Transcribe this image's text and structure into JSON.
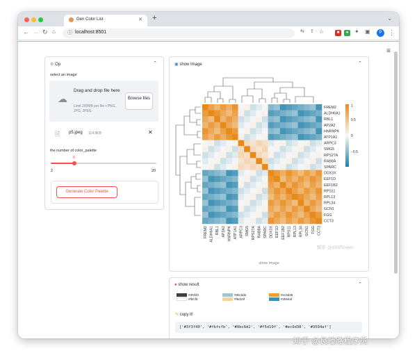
{
  "browser": {
    "tab_title": "Gen Color List",
    "url": "localhost:8501",
    "profile_initial": "P"
  },
  "sidebar": {
    "header": "Op",
    "upload_label": "select an image",
    "dropzone_title": "Drag and drop file here",
    "dropzone_hint": "Limit 200MB per file • PNG, JPG, JPEG",
    "browse_label": "Browse files",
    "file_name": "p5.jpeg",
    "file_size": "114.9KB",
    "slider_label": "the number of color_palette",
    "slider_value": 6,
    "slider_min": "2",
    "slider_max": "20",
    "slider_value_fraction": 0.222,
    "generate_label": "Generate Color Palette"
  },
  "image_panel": {
    "header": "show Image",
    "caption": "show image",
    "colorbar_ticks": [
      "1",
      "0.5",
      "0",
      "−0.5"
    ],
    "row_labels": [
      "FREM2",
      "ALDH6A1",
      "RBL1",
      "AP2A2",
      "HNRNPK",
      "ATP1A1",
      "ARPC3",
      "SMG5",
      "RPS27A",
      "RAB8A",
      "SPARC",
      "DDX3X",
      "EEF1D",
      "EEF1B2",
      "RPS11",
      "RPL13",
      "RPL34",
      "GCN1",
      "FGG",
      "CCT3"
    ],
    "col_labels": [
      "FREM2",
      "ALDH6A1",
      "RBL1",
      "AP2A2",
      "HNRNPK",
      "ATP1A1",
      "ARPC3",
      "SMG5",
      "RPS27A",
      "RAB8A",
      "SPARC",
      "DDX3X",
      "EEF1D",
      "EEF1B2",
      "RPS11",
      "RPL13",
      "RPL34",
      "GCN1",
      "FGG",
      "CCT3"
    ],
    "watermark": "知乎 @stillflower"
  },
  "result_panel": {
    "header": "show result",
    "palette": [
      {
        "hex": "#3f3f40",
        "label": "#3f3f40"
      },
      {
        "hex": "#fbfcfb",
        "label": "#fbfcfb"
      },
      {
        "hex": "#9bc6d2",
        "label": "#9bc6d2"
      },
      {
        "hex": "#f5d19f",
        "label": "#f5d19f"
      },
      {
        "hex": "#ec9d38",
        "label": "#ec9d38"
      },
      {
        "hex": "#3594af",
        "label": "#3594af"
      }
    ],
    "copy_label": "copy it!",
    "copy_text": "['#3f3f40', '#fbfcfb', '#9bc6d2', '#f5d19f', '#ec9d38', '#3594af']"
  },
  "page_watermark": "知乎 @良睦路程序员",
  "colors": {
    "accent": "#ff4b4b",
    "heat_pos": "#e88a1a",
    "heat_neg": "#1f7fa8"
  }
}
